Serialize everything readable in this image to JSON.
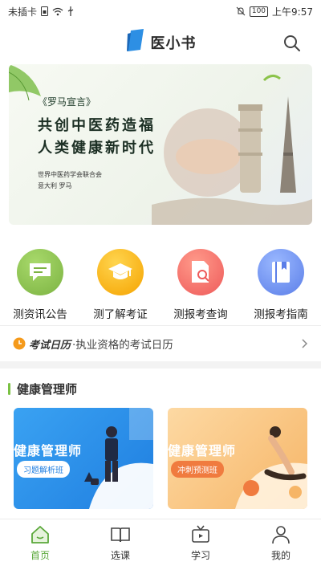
{
  "status_bar": {
    "carrier": "未插卡",
    "battery": "100",
    "time": "上午9:57"
  },
  "header": {
    "title": "医小书"
  },
  "banner": {
    "tag": "《罗马宣言》",
    "headline_line1": "共创中医药造福",
    "headline_line2": "人类健康新时代",
    "org": "世界中医药学会联合会",
    "place": "意大利 罗马"
  },
  "quick_menu": [
    {
      "label": "测资讯公告",
      "icon": "message-icon",
      "color": "#8bc34a"
    },
    {
      "label": "测了解考证",
      "icon": "graduation-cap-icon",
      "color": "#f6b400"
    },
    {
      "label": "测报考查询",
      "icon": "document-search-icon",
      "color": "#f36f6f"
    },
    {
      "label": "测报考指南",
      "icon": "book-icon",
      "color": "#6b8df2"
    }
  ],
  "exam_calendar": {
    "badge": "考试日历",
    "text": "·执业资格的考试日历"
  },
  "section": {
    "title": "健康管理师"
  },
  "courses": [
    {
      "title": "健康管理师",
      "pill": "习题解析班"
    },
    {
      "title": "健康管理师",
      "pill": "冲刺预测班"
    }
  ],
  "tabs": [
    {
      "label": "首页",
      "icon": "home-icon",
      "active": true
    },
    {
      "label": "选课",
      "icon": "open-book-icon",
      "active": false
    },
    {
      "label": "学习",
      "icon": "tv-icon",
      "active": false
    },
    {
      "label": "我的",
      "icon": "person-icon",
      "active": false
    }
  ],
  "colors": {
    "accent": "#5aa83a",
    "section_bar": "#7ac143"
  }
}
